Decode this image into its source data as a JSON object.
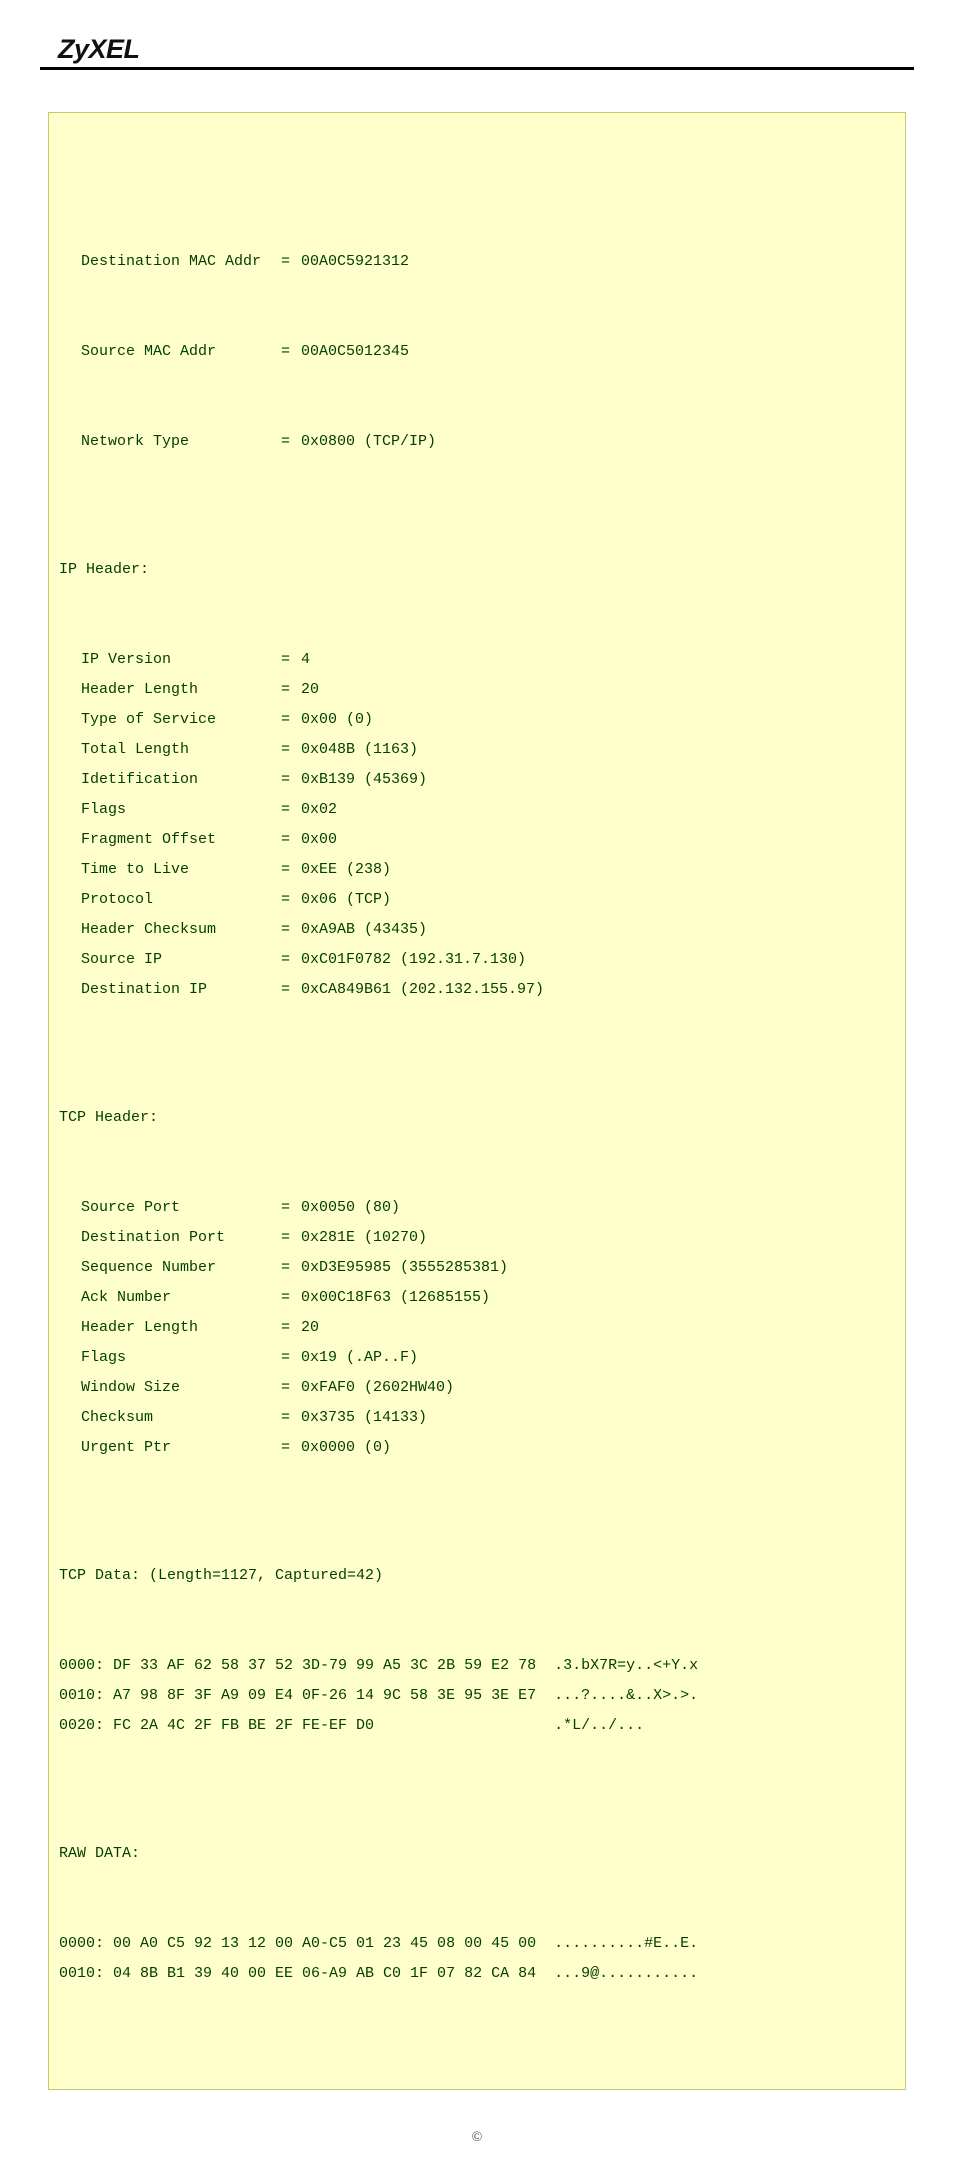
{
  "brand": "ZyXEL",
  "mac": {
    "dest_label": "Destination MAC Addr",
    "dest_value": "00A0C5921312",
    "src_label": "Source MAC Addr",
    "src_value": "00A0C5012345",
    "net_label": "Network Type",
    "net_value": "0x0800 (TCP/IP)"
  },
  "ip_header_title": "IP Header:",
  "ip": [
    {
      "label": "IP Version",
      "value": "4"
    },
    {
      "label": "Header Length",
      "value": "20"
    },
    {
      "label": "Type of Service",
      "value": "0x00 (0)"
    },
    {
      "label": "Total Length",
      "value": "0x048B (1163)"
    },
    {
      "label": "Idetification",
      "value": "0xB139 (45369)"
    },
    {
      "label": "Flags",
      "value": "0x02"
    },
    {
      "label": "Fragment Offset",
      "value": "0x00"
    },
    {
      "label": "Time to Live",
      "value": "0xEE (238)"
    },
    {
      "label": "Protocol",
      "value": "0x06 (TCP)"
    },
    {
      "label": "Header Checksum",
      "value": "0xA9AB (43435)"
    },
    {
      "label": "Source IP",
      "value": "0xC01F0782 (192.31.7.130)"
    },
    {
      "label": "Destination IP",
      "value": "0xCA849B61 (202.132.155.97)"
    }
  ],
  "tcp_header_title": "TCP Header:",
  "tcp": [
    {
      "label": "Source Port",
      "value": "0x0050 (80)"
    },
    {
      "label": "Destination Port",
      "value": "0x281E (10270)"
    },
    {
      "label": "Sequence Number",
      "value": "0xD3E95985 (3555285381)"
    },
    {
      "label": "Ack Number",
      "value": "0x00C18F63 (12685155)"
    },
    {
      "label": "Header Length",
      "value": "20"
    },
    {
      "label": "Flags",
      "value": "0x19 (.AP..F)"
    },
    {
      "label": "Window Size",
      "value": "0xFAF0 (2602HW40)"
    },
    {
      "label": "Checksum",
      "value": "0x3735 (14133)"
    },
    {
      "label": "Urgent Ptr",
      "value": "0x0000 (0)"
    }
  ],
  "tcp_data_title": "TCP Data: (Length=1127, Captured=42)",
  "tcp_data_lines": [
    "0000: DF 33 AF 62 58 37 52 3D-79 99 A5 3C 2B 59 E2 78  .3.bX7R=y..<+Y.x",
    "0010: A7 98 8F 3F A9 09 E4 0F-26 14 9C 58 3E 95 3E E7  ...?....&..X>.>.",
    "0020: FC 2A 4C 2F FB BE 2F FE-EF D0                    .*L/../..."
  ],
  "raw_data_title": "RAW DATA:",
  "raw_data_lines": [
    "0000: 00 A0 C5 92 13 12 00 A0-C5 01 23 45 08 00 45 00  ..........#E..E.",
    "0010: 04 8B B1 39 40 00 EE 06-A9 AB C0 1F 07 82 CA 84  ...9@..........."
  ],
  "footer": "©"
}
